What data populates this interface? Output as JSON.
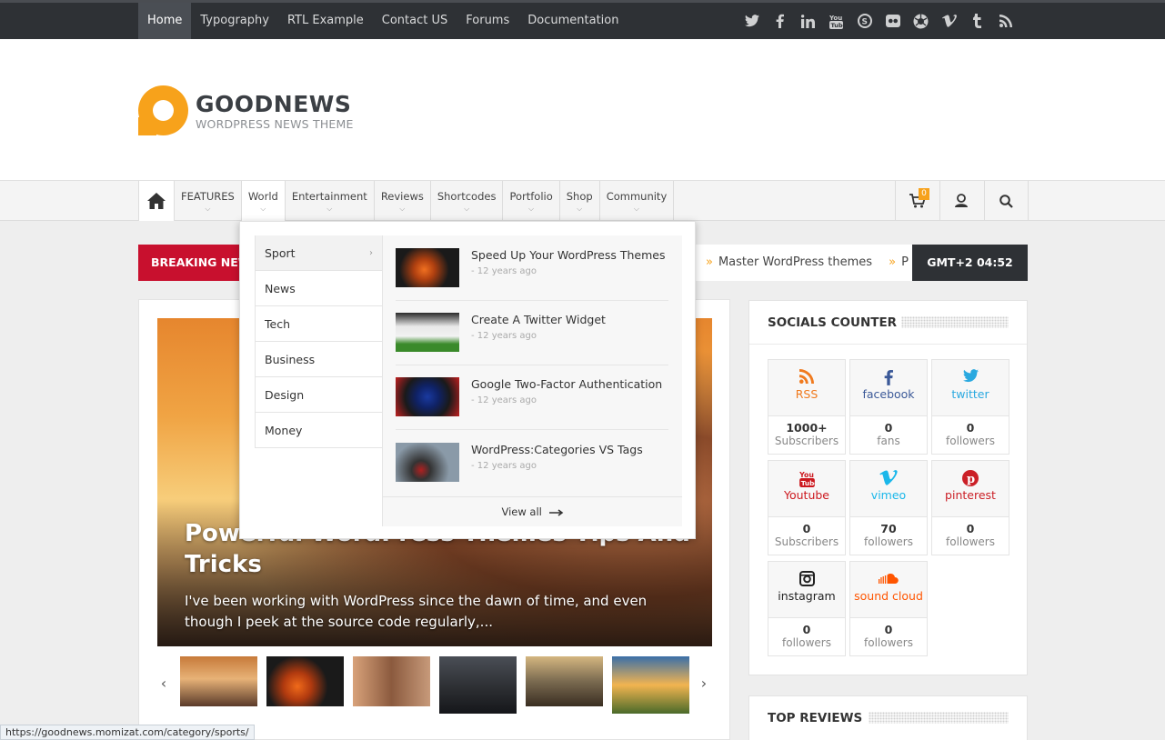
{
  "topnav": {
    "items": [
      "Home",
      "Typography",
      "RTL Example",
      "Contact US",
      "Forums",
      "Documentation"
    ],
    "social_icons": [
      "twitter-icon",
      "facebook-icon",
      "linkedin-icon",
      "youtube-icon",
      "skype-icon",
      "flickr-icon",
      "picasa-icon",
      "vimeo-icon",
      "tumblr-icon",
      "rss-icon"
    ]
  },
  "logo": {
    "title": "GOODNEWS",
    "subtitle": "WORDPRESS NEWS THEME"
  },
  "mainnav": {
    "items": [
      "FEATURES",
      "World",
      "Entertainment",
      "Reviews",
      "Shortcodes",
      "Portfolio",
      "Shop",
      "Community"
    ],
    "cart_count": "0"
  },
  "breaking": {
    "label": "BREAKING NEWS",
    "ticker": [
      "Master WordPress themes",
      "P"
    ],
    "time": "GMT+2 04:52"
  },
  "hero": {
    "title": "Powerful WordPress Themes Tips And Tricks",
    "excerpt": "I've been working with WordPress since the dawn of time, and even though I peek at the source code regularly,..."
  },
  "dropdown": {
    "categories": [
      "Sport",
      "News",
      "Tech",
      "Business",
      "Design",
      "Money"
    ],
    "posts": [
      {
        "title": "Speed Up Your WordPress Themes",
        "date": "- 12 years ago"
      },
      {
        "title": "Create A Twitter Widget",
        "date": "- 12 years ago"
      },
      {
        "title": "Google Two-Factor Authentication",
        "date": "- 12 years ago"
      },
      {
        "title": "WordPress:Categories VS Tags",
        "date": "- 12 years ago"
      }
    ],
    "view_all": "View all"
  },
  "socials": {
    "title": "SOCIALS COUNTER",
    "items": [
      {
        "name": "RSS",
        "count": "1000+",
        "unit": "Subscribers",
        "color": "#f07a1e"
      },
      {
        "name": "facebook",
        "count": "0",
        "unit": "fans",
        "color": "#3b5998"
      },
      {
        "name": "twitter",
        "count": "0",
        "unit": "followers",
        "color": "#2aa9e0"
      },
      {
        "name": "Youtube",
        "count": "0",
        "unit": "Subscribers",
        "color": "#cc181e"
      },
      {
        "name": "vimeo",
        "count": "70",
        "unit": "followers",
        "color": "#1ab7ea"
      },
      {
        "name": "pinterest",
        "count": "0",
        "unit": "followers",
        "color": "#cb2027"
      },
      {
        "name": "instagram",
        "count": "0",
        "unit": "followers",
        "color": "#222222"
      },
      {
        "name": "sound cloud",
        "count": "0",
        "unit": "followers",
        "color": "#ff5500"
      }
    ]
  },
  "top_reviews": {
    "title": "TOP REVIEWS"
  },
  "status_url": "https://goodnews.momizat.com/category/sports/"
}
